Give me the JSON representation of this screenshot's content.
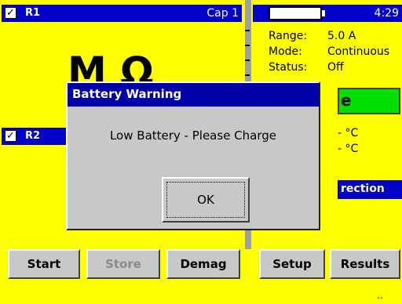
{
  "left_panel": {
    "r1": {
      "label": "R1",
      "cap_label": "Cap 1"
    },
    "big_reading": "M Ω",
    "r2": {
      "label": "R2"
    }
  },
  "right_panel": {
    "time": "4:29",
    "range_label": "Range:",
    "range_value": "5.0 A",
    "mode_label": "Mode:",
    "mode_value": "Continuous",
    "status_label": "Status:",
    "status_value": "Off",
    "green_button_fragment": "e",
    "temp1": "- °C",
    "temp2": "- °C",
    "direction_fragment": "rection"
  },
  "buttons": {
    "start": "Start",
    "store": "Store",
    "demag": "Demag",
    "setup": "Setup",
    "results": "Results"
  },
  "dialog": {
    "title": "Battery Warning",
    "message": "Low Battery - Please Charge",
    "ok": "OK"
  },
  "footer_dots": ".."
}
